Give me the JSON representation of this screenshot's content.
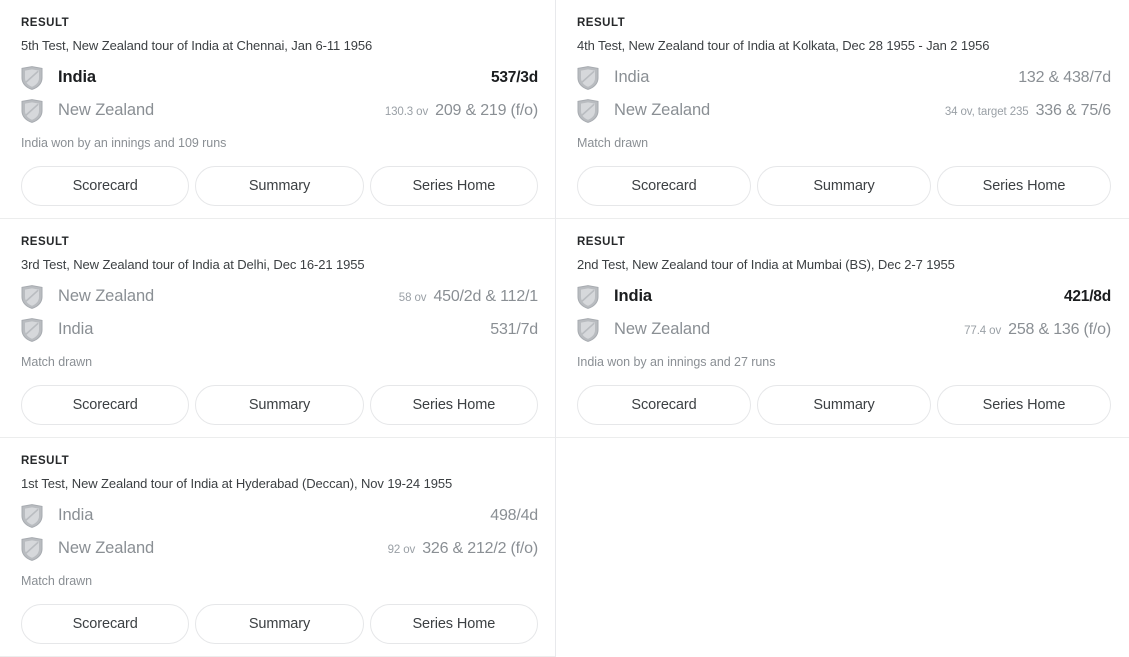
{
  "ui": {
    "result_label": "RESULT",
    "flag_icon_name": "team-flag-placeholder-icon",
    "accent_color": "#1b1d1f",
    "muted_color": "#8a8f94",
    "divider_color": "#e8e9ec",
    "buttons": [
      "Scorecard",
      "Summary",
      "Series Home"
    ]
  },
  "matches": [
    {
      "result_label": "RESULT",
      "title": "5th Test, New Zealand tour of India at Chennai, Jan 6-11 1956",
      "teams": [
        {
          "name": "India",
          "overs": "",
          "score": "537/3d",
          "winner": true
        },
        {
          "name": "New Zealand",
          "overs": "130.3 ov",
          "score": "209 & 219 (f/o)",
          "winner": false
        }
      ],
      "status": "India won by an innings and 109 runs",
      "buttons": [
        "Scorecard",
        "Summary",
        "Series Home"
      ]
    },
    {
      "result_label": "RESULT",
      "title": "4th Test, New Zealand tour of India at Kolkata, Dec 28 1955 - Jan 2 1956",
      "teams": [
        {
          "name": "India",
          "overs": "",
          "score": "132 & 438/7d",
          "winner": false
        },
        {
          "name": "New Zealand",
          "overs": "34 ov, target 235",
          "score": "336 & 75/6",
          "winner": false
        }
      ],
      "status": "Match drawn",
      "buttons": [
        "Scorecard",
        "Summary",
        "Series Home"
      ]
    },
    {
      "result_label": "RESULT",
      "title": "3rd Test, New Zealand tour of India at Delhi, Dec 16-21 1955",
      "teams": [
        {
          "name": "New Zealand",
          "overs": "58 ov",
          "score": "450/2d & 112/1",
          "winner": false
        },
        {
          "name": "India",
          "overs": "",
          "score": "531/7d",
          "winner": false
        }
      ],
      "status": "Match drawn",
      "buttons": [
        "Scorecard",
        "Summary",
        "Series Home"
      ]
    },
    {
      "result_label": "RESULT",
      "title": "2nd Test, New Zealand tour of India at Mumbai (BS), Dec 2-7 1955",
      "teams": [
        {
          "name": "India",
          "overs": "",
          "score": "421/8d",
          "winner": true
        },
        {
          "name": "New Zealand",
          "overs": "77.4 ov",
          "score": "258 & 136 (f/o)",
          "winner": false
        }
      ],
      "status": "India won by an innings and 27 runs",
      "buttons": [
        "Scorecard",
        "Summary",
        "Series Home"
      ]
    },
    {
      "result_label": "RESULT",
      "title": "1st Test, New Zealand tour of India at Hyderabad (Deccan), Nov 19-24 1955",
      "teams": [
        {
          "name": "India",
          "overs": "",
          "score": "498/4d",
          "winner": false
        },
        {
          "name": "New Zealand",
          "overs": "92 ov",
          "score": "326 & 212/2 (f/o)",
          "winner": false
        }
      ],
      "status": "Match drawn",
      "buttons": [
        "Scorecard",
        "Summary",
        "Series Home"
      ]
    }
  ]
}
